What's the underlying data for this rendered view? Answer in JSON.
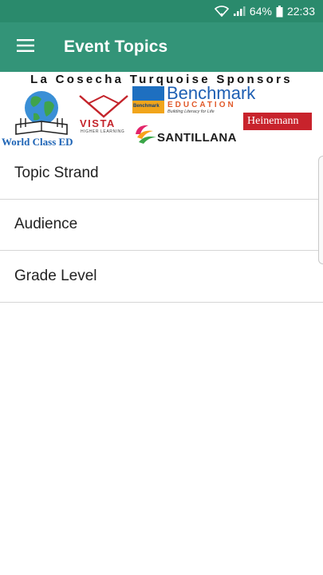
{
  "status_bar": {
    "battery": "64%",
    "time": "22:33",
    "icons": [
      "wifi-icon",
      "signal-icon",
      "battery-icon"
    ]
  },
  "app_bar": {
    "title": "Event Topics",
    "menu_icon": "hamburger-menu-icon"
  },
  "banner": {
    "title": "La Cosecha Turquoise Sponsors",
    "sponsors": {
      "world_class_ed": "World Class ED",
      "vista": "VISTA",
      "vista_sub": "HIGHER LEARNING",
      "benchmark": "Benchmark",
      "benchmark_education": "EDUCATION",
      "benchmark_tagline": "Building Literacy for Life",
      "benchmark_badge": "Benchmark",
      "heinemann": "Heinemann",
      "santillana": "SANTILLANA"
    }
  },
  "topics": [
    {
      "label": "Topic Strand"
    },
    {
      "label": "Audience"
    },
    {
      "label": "Grade Level"
    }
  ],
  "colors": {
    "status_bar": "#2a8a6c",
    "app_bar": "#339478",
    "divider": "#d6d6d6"
  }
}
